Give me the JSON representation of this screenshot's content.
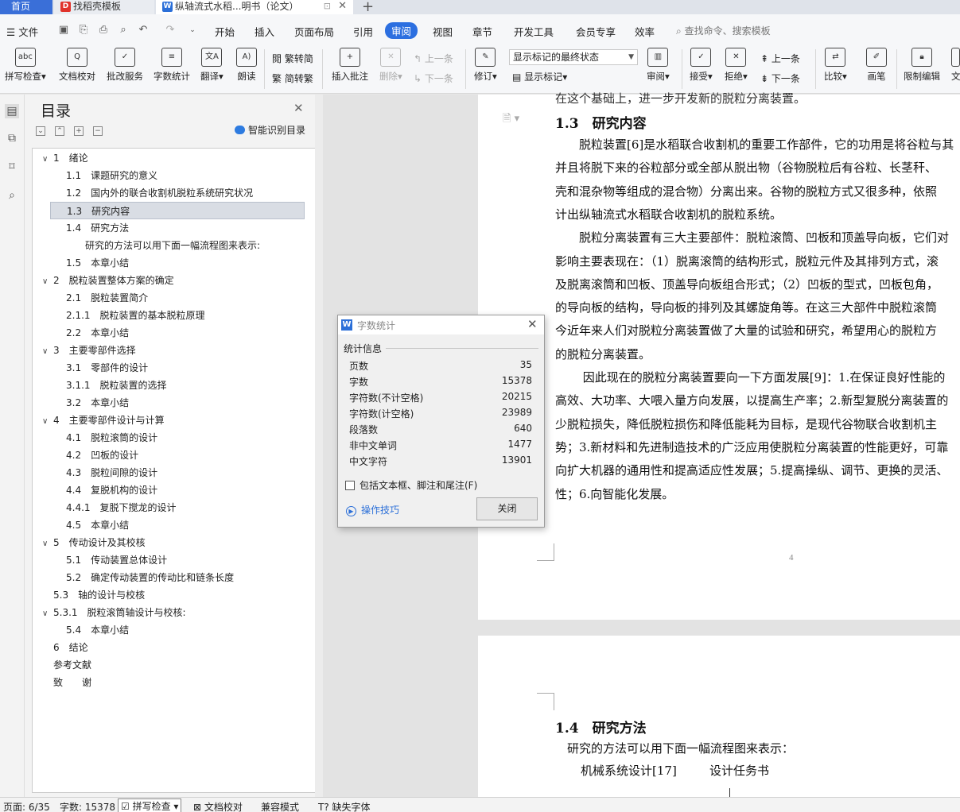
{
  "tabs": {
    "home": "首页",
    "t1": "找稻壳模板",
    "t2": "纵轴流式水稻...明书（论文）"
  },
  "menu": {
    "file": "文件",
    "items": [
      "开始",
      "插入",
      "页面布局",
      "引用",
      "审阅",
      "视图",
      "章节",
      "开发工具",
      "会员专享",
      "效率"
    ],
    "search": "查找命令、搜索模板"
  },
  "ribbon": {
    "spell": "拼写检查",
    "doccheck": "文档校对",
    "batch": "批改服务",
    "wordcount": "字数统计",
    "translate": "翻译",
    "read": "朗读",
    "trad": "繁转简",
    "simp": "简转繁",
    "insert_comment": "插入批注",
    "delete": "删除",
    "prev_comment": "上一条",
    "next_comment": "下一条",
    "revise": "修订",
    "show_state": "显示标记的最终状态",
    "show_marks": "显示标记",
    "review": "审阅",
    "accept": "接受",
    "reject": "拒绝",
    "prev": "上一条",
    "next": "下一条",
    "compare": "比较",
    "pen": "画笔",
    "restrict": "限制编辑",
    "doc": "文"
  },
  "toc": {
    "title": "目录",
    "smart": "智能识别目录",
    "items": [
      {
        "chev": "∨",
        "text": "1　绪论"
      },
      {
        "chev": "",
        "text": "1.1　课题研究的意义"
      },
      {
        "chev": "",
        "text": "1.2　国内外的联合收割机脱粒系统研究状况"
      },
      {
        "chev": "",
        "text": "1.3　研究内容"
      },
      {
        "chev": "",
        "text": "1.4　研究方法"
      },
      {
        "chev": "",
        "text": "研究的方法可以用下面一幅流程图来表示:"
      },
      {
        "chev": "",
        "text": "1.5　本章小结"
      },
      {
        "chev": "∨",
        "text": "2　脱粒装置整体方案的确定"
      },
      {
        "chev": "",
        "text": "2.1　脱粒装置简介"
      },
      {
        "chev": "",
        "text": "2.1.1　脱粒装置的基本脱粒原理"
      },
      {
        "chev": "",
        "text": "2.2　本章小结"
      },
      {
        "chev": "∨",
        "text": "3　主要零部件选择"
      },
      {
        "chev": "",
        "text": "3.1　零部件的设计"
      },
      {
        "chev": "",
        "text": "3.1.1　脱粒装置的选择"
      },
      {
        "chev": "",
        "text": "3.2　本章小结"
      },
      {
        "chev": "∨",
        "text": "4　主要零部件设计与计算"
      },
      {
        "chev": "",
        "text": "4.1　脱粒滚筒的设计"
      },
      {
        "chev": "",
        "text": "4.2　凹板的设计"
      },
      {
        "chev": "",
        "text": "4.3　脱粒间隙的设计"
      },
      {
        "chev": "",
        "text": "4.4　复脱机构的设计"
      },
      {
        "chev": "",
        "text": "4.4.1　复脱下搅龙的设计"
      },
      {
        "chev": "",
        "text": "4.5　本章小结"
      },
      {
        "chev": "∨",
        "text": "5　传动设计及其校核"
      },
      {
        "chev": "",
        "text": "5.1　传动装置总体设计"
      },
      {
        "chev": "",
        "text": "5.2　确定传动装置的传动比和链条长度"
      },
      {
        "chev": "",
        "text": "5.3　轴的设计与校核"
      },
      {
        "chev": "∨",
        "text": "5.3.1　脱粒滚筒轴设计与校核:"
      },
      {
        "chev": "",
        "text": "5.4　本章小结"
      },
      {
        "chev": "",
        "text": "6　结论"
      },
      {
        "chev": "",
        "text": "参考文献"
      },
      {
        "chev": "",
        "text": "致　　谢"
      }
    ]
  },
  "doc": {
    "top_line": "在这个基础上，进一步开发新的脱粒分离装置。",
    "h13": "1.3　研究内容",
    "lines": [
      "　　脱粒装置[6]是水稻联合收割机的重要工作部件，它的功用是将谷粒与其",
      "并且将脱下来的谷粒部分或全部从脱出物（谷物脱粒后有谷粒、长茎秆、",
      "壳和混杂物等组成的混合物）分离出来。谷物的脱粒方式又很多种，依照",
      "计出纵轴流式水稻联合收割机的脱粒系统。",
      "　　脱粒分离装置有三大主要部件：脱粒滚筒、凹板和顶盖导向板，它们对",
      "影响主要表现在：（1）脱离滚筒的结构形式，脱粒元件及其排列方式，滚",
      "及脱离滚筒和凹板、顶盖导向板组合形式；（2）凹板的型式，凹板包角，",
      "的导向板的结构，导向板的排列及其螺旋角等。在这三大部件中脱粒滚筒",
      "今近年来人们对脱粒分离装置做了大量的试验和研究，希望用心的脱粒方",
      "的脱粒分离装置。",
      "　　 因此现在的脱粒分离装置要向一下方面发展[9]：1.在保证良好性能的",
      "高效、大功率、大喂入量方向发展，以提高生产率；2.新型复脱分离装置的",
      "少脱粒损失，降低脱粒损伤和降低能耗为目标，是现代谷物联合收割机主",
      "势；3.新材料和先进制造技术的广泛应用使脱粒分离装置的性能更好，可靠",
      "向扩大机器的通用性和提高适应性发展；5.提高操纵、调节、更换的灵活、",
      "性；6.向智能化发展。"
    ],
    "page_num": "4",
    "h14": "1.4　研究方法",
    "p2_line": "　研究的方法可以用下面一幅流程图来表示：",
    "flow_a": "机械系统设计[17]",
    "flow_b": "设计任务书"
  },
  "dialog": {
    "title": "字数统计",
    "section": "统计信息",
    "stats": [
      {
        "label": "页数",
        "value": "35"
      },
      {
        "label": "字数",
        "value": "15378"
      },
      {
        "label": "字符数(不计空格)",
        "value": "20215"
      },
      {
        "label": "字符数(计空格)",
        "value": "23989"
      },
      {
        "label": "段落数",
        "value": "640"
      },
      {
        "label": "非中文单词",
        "value": "1477"
      },
      {
        "label": "中文字符",
        "value": "13901"
      }
    ],
    "include": "包括文本框、脚注和尾注(F)",
    "tips": "操作技巧",
    "close": "关闭"
  },
  "status": {
    "page": "页面: 6/35",
    "words": "字数: 15378",
    "spell": "拼写检查",
    "doccheck": "文档校对",
    "compat": "兼容模式",
    "missing_font": "缺失字体"
  }
}
